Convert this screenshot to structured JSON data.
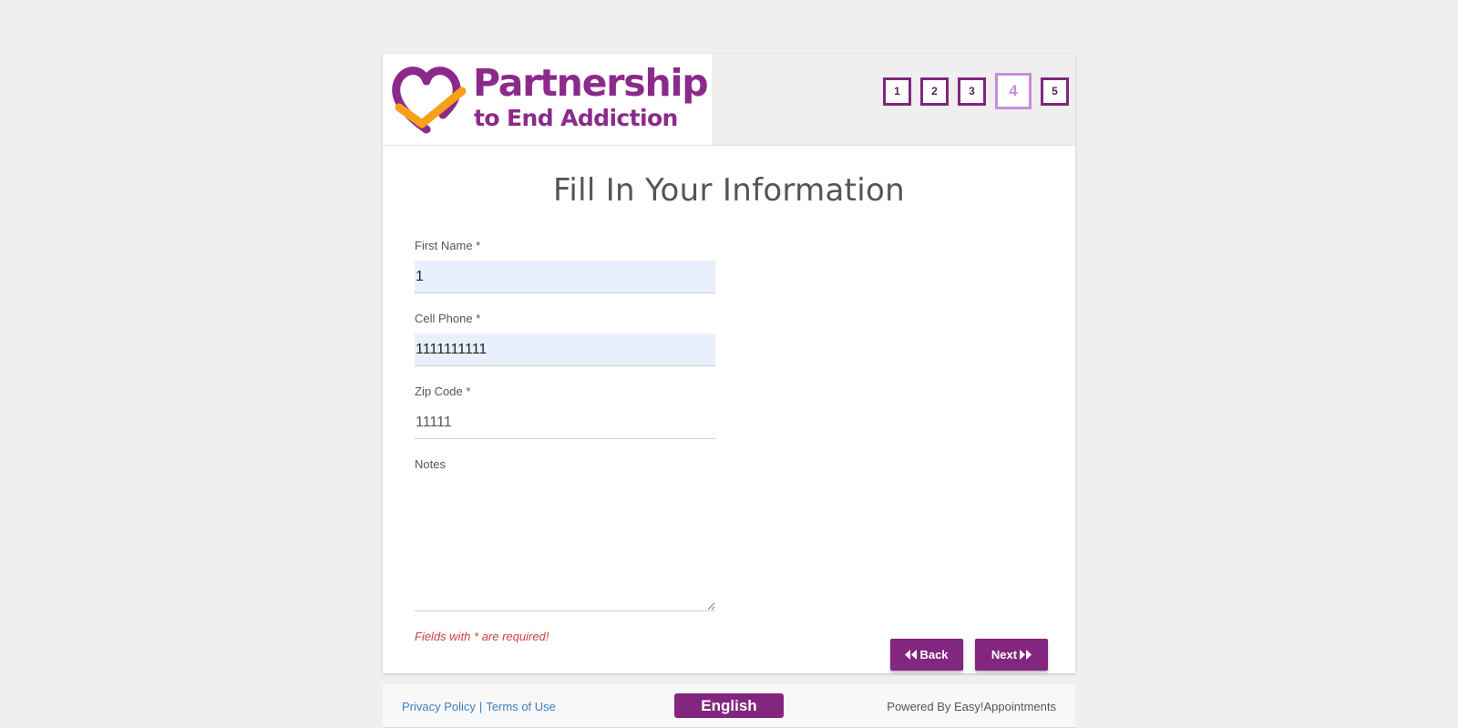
{
  "brand": {
    "line1": "Partnership",
    "line2": "to End Addiction",
    "purple": "#8b2a8b",
    "orange": "#f7a11a"
  },
  "steps": [
    "1",
    "2",
    "3",
    "4",
    "5"
  ],
  "active_step": "4",
  "form": {
    "title": "Fill In Your Information",
    "first_name": {
      "label": "First Name *",
      "value": "1"
    },
    "cell_phone": {
      "label": "Cell Phone *",
      "value": "1111111111"
    },
    "zip_code": {
      "label": "Zip Code *",
      "value": "11111"
    },
    "notes": {
      "label": "Notes",
      "value": ""
    },
    "required_note": "Fields with * are required!"
  },
  "buttons": {
    "back": "Back",
    "next": "Next"
  },
  "footer": {
    "privacy": "Privacy Policy",
    "separator": "|",
    "terms": "Terms of Use",
    "language": "English",
    "powered_by": "Powered By Easy!Appointments"
  },
  "colors": {
    "accent": "#82267f",
    "active_step": "#c58fd9",
    "error": "#c9443e",
    "link": "#3f7fbf"
  },
  "icons": {
    "back": "double-chevron-left-icon",
    "next": "double-chevron-right-icon"
  }
}
